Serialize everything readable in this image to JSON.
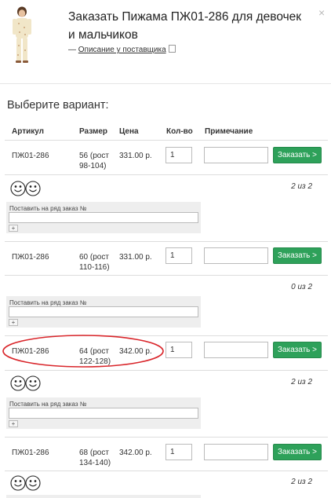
{
  "header": {
    "title": "Заказать Пижама ПЖ01-286 для девочек и мальчиков",
    "description_prefix": "— ",
    "description_link": "Описание у поставщика",
    "close_label": "×"
  },
  "section_title": "Выберите вариант:",
  "columns": {
    "article": "Артикул",
    "size": "Размер",
    "price": "Цена",
    "qty": "Кол-во",
    "note": "Примечание"
  },
  "rows": [
    {
      "article": "ПЖ01-286",
      "size_line1": "56 (рост",
      "size_line2": "98-104)",
      "price": "331.00 р.",
      "qty": "1",
      "order_label": "Заказать >",
      "stock": "2 из 2"
    },
    {
      "article": "ПЖ01-286",
      "size_line1": "60 (рост",
      "size_line2": "110-116)",
      "price": "331.00 р.",
      "qty": "1",
      "order_label": "Заказать >",
      "stock": "0 из 2"
    },
    {
      "article": "ПЖ01-286",
      "size_line1": "64 (рост",
      "size_line2": "122-128)",
      "price": "342.00 р.",
      "qty": "1",
      "order_label": "Заказать >",
      "stock": "2 из 2"
    },
    {
      "article": "ПЖ01-286",
      "size_line1": "68 (рост",
      "size_line2": "134-140)",
      "price": "342.00 р.",
      "qty": "1",
      "order_label": "Заказать >",
      "stock": "2 из 2"
    }
  ],
  "series_order": {
    "label": "Поставить на ряд заказ №",
    "add_label": "+"
  },
  "colors": {
    "order_button": "#2ea15a",
    "highlight_oval": "#d9262b"
  }
}
